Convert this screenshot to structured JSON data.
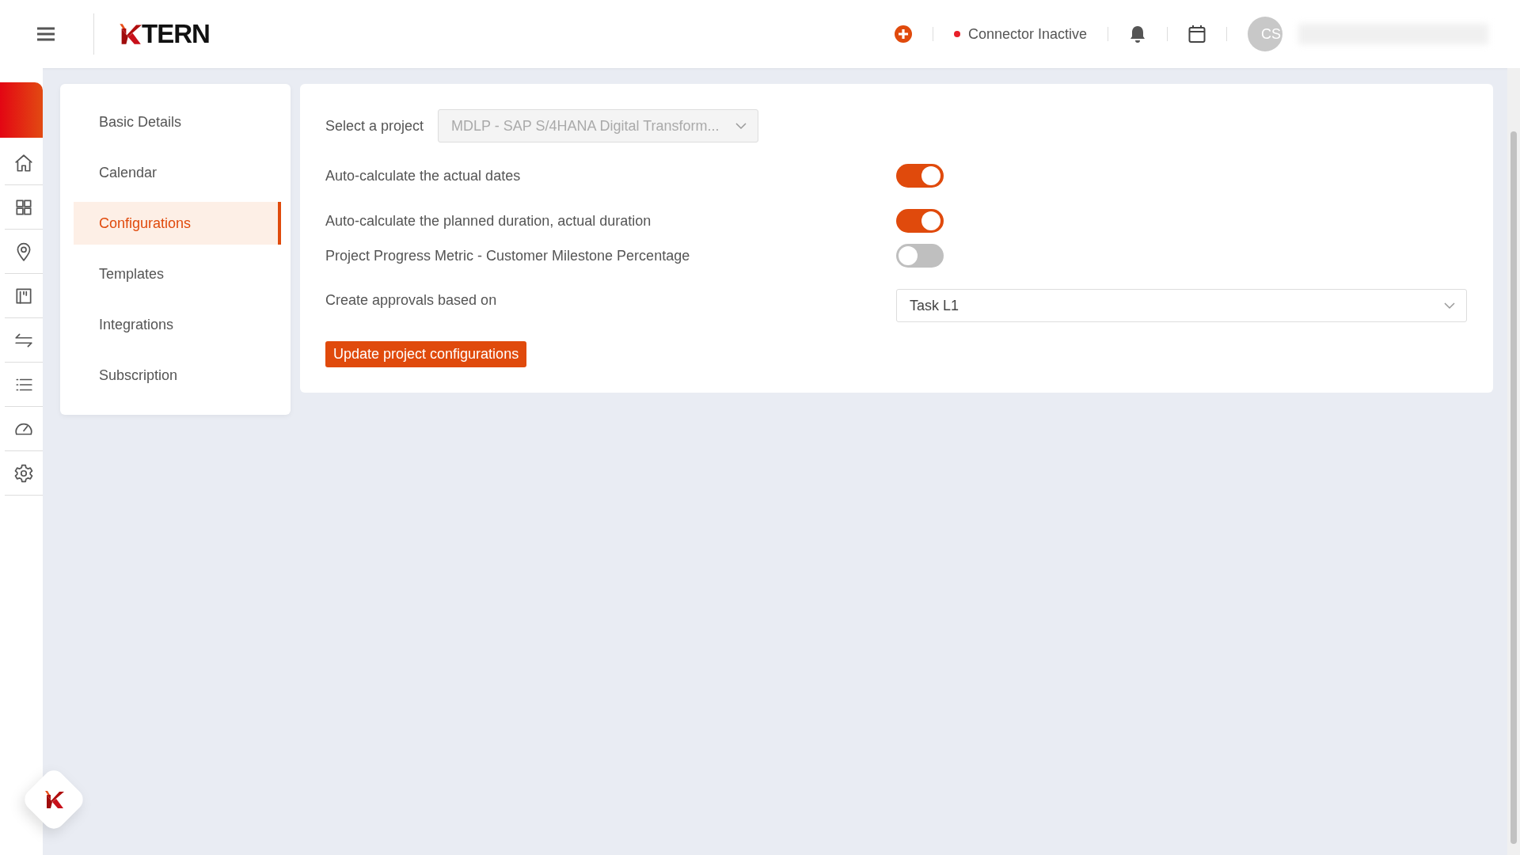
{
  "header": {
    "logo_text": "TERN",
    "connector": {
      "label": "Connector Inactive",
      "color": "#e8202a"
    },
    "avatar_initials": "CS"
  },
  "sidebar": {
    "items": [
      {
        "kind": "home"
      },
      {
        "kind": "grid"
      },
      {
        "kind": "pin"
      },
      {
        "kind": "board"
      },
      {
        "kind": "swap"
      },
      {
        "kind": "list"
      },
      {
        "kind": "gauge"
      },
      {
        "kind": "settings"
      }
    ]
  },
  "settings_menu": {
    "items": [
      {
        "label": "Basic Details",
        "selected": false
      },
      {
        "label": "Calendar",
        "selected": false
      },
      {
        "label": "Configurations",
        "selected": true
      },
      {
        "label": "Templates",
        "selected": false
      },
      {
        "label": "Integrations",
        "selected": false
      },
      {
        "label": "Subscription",
        "selected": false
      }
    ]
  },
  "form": {
    "project": {
      "label": "Select a project",
      "value": "MDLP - SAP S/4HANA Digital Transform...",
      "disabled": true
    },
    "toggles": [
      {
        "label": "Auto-calculate the actual dates",
        "on": true
      },
      {
        "label": "Auto-calculate the planned duration, actual duration",
        "on": true
      },
      {
        "label": "Project Progress Metric - Customer Milestone Percentage",
        "on": false
      }
    ],
    "approvals": {
      "label": "Create approvals based on",
      "value": "Task L1"
    },
    "submit": "Update project configurations"
  }
}
